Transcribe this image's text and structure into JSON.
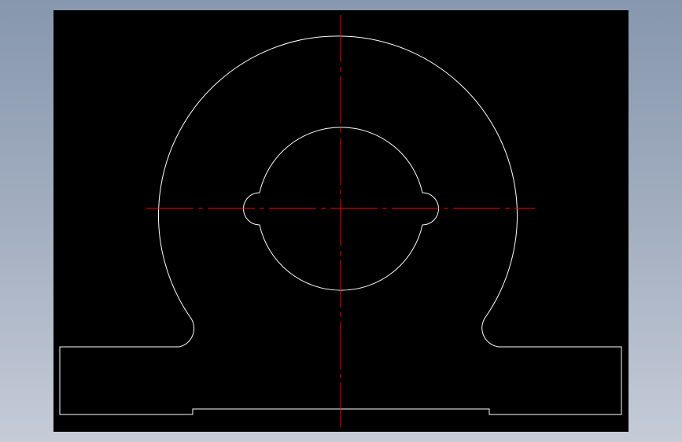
{
  "window": {
    "background_gradient": [
      "#8797ae",
      "#c5ccd8"
    ]
  },
  "viewport": {
    "background": "#000000",
    "outline_color": "#ffffff",
    "centerline_color": "#ff0000",
    "view": "front-elevation",
    "part": "pillow-block-housing",
    "features": [
      "outer-arc",
      "shaft-bore",
      "keyway-lobe-left",
      "keyway-lobe-right",
      "fillet-left",
      "fillet-right",
      "base-plate",
      "base-relief-slot",
      "horizontal-centerline",
      "vertical-centerline"
    ]
  }
}
